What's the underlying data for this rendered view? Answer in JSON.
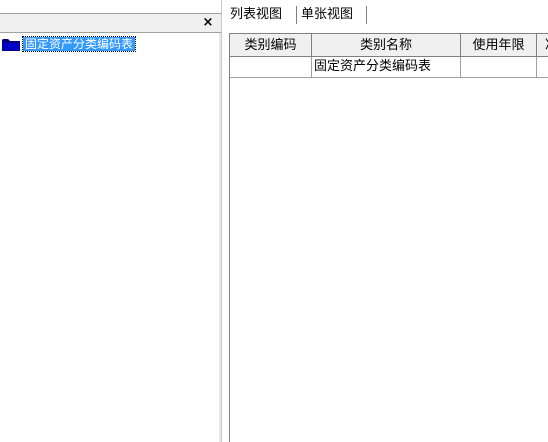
{
  "tree": {
    "root_label": "固定资产分类编码表"
  },
  "left_header": {
    "close_label": "×"
  },
  "tabs": [
    {
      "label": "列表视图"
    },
    {
      "label": "单张视图"
    }
  ],
  "grid": {
    "columns": [
      "类别编码",
      "类别名称",
      "使用年限",
      "净"
    ],
    "rows": [
      [
        "",
        "固定资产分类编码表",
        "",
        ""
      ]
    ]
  },
  "colors": {
    "selection": "#3399ff",
    "folder": "#000080"
  },
  "icons": {
    "folder": "folder-icon",
    "close": "close-icon"
  }
}
